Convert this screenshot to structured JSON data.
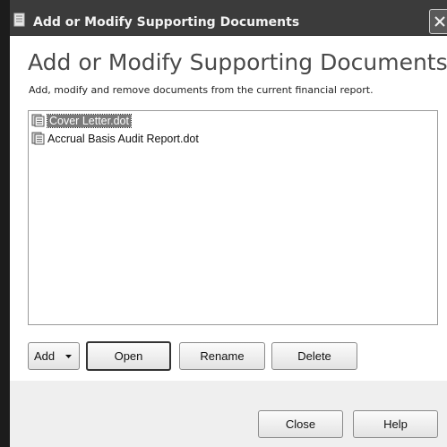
{
  "window": {
    "title": "Add or Modify Supporting Documents",
    "close_glyph": "✕"
  },
  "main": {
    "heading": "Add or Modify Supporting Documents",
    "description": "Add, modify and remove documents from the current financial report."
  },
  "documents": [
    {
      "name": "Cover Letter.dot",
      "selected": true,
      "icon": "document-icon"
    },
    {
      "name": "Accrual Basis Audit Report.dot",
      "selected": false,
      "icon": "document-icon"
    }
  ],
  "actions": {
    "add_label": "Add",
    "open_label": "Open",
    "rename_label": "Rename",
    "delete_label": "Delete"
  },
  "footer": {
    "close_label": "Close",
    "help_label": "Help"
  }
}
